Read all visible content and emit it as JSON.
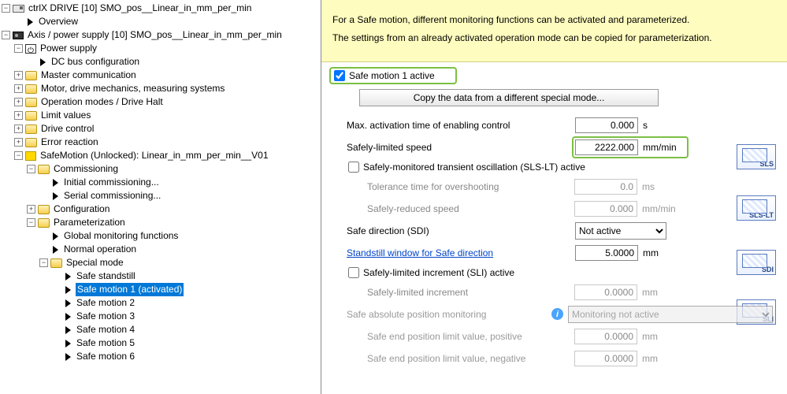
{
  "tree": {
    "root": "ctrlX DRIVE [10] SMO_pos__Linear_in_mm_per_min",
    "overview": "Overview",
    "axis": "Axis / power supply [10] SMO_pos__Linear_in_mm_per_min",
    "power_supply": "Power supply",
    "dc_bus": "DC bus configuration",
    "master_comm": "Master communication",
    "motor": "Motor, drive mechanics, measuring systems",
    "op_modes": "Operation modes / Drive Halt",
    "limit_values": "Limit values",
    "drive_control": "Drive control",
    "error_reaction": "Error reaction",
    "safemotion": "SafeMotion (Unlocked): Linear_in_mm_per_min__V01",
    "commissioning": "Commissioning",
    "initial_comm": "Initial commissioning...",
    "serial_comm": "Serial commissioning...",
    "configuration": "Configuration",
    "parameterization": "Parameterization",
    "global_mon": "Global monitoring functions",
    "normal_op": "Normal operation",
    "special_mode": "Special mode",
    "safe_standstill": "Safe standstill",
    "safe_motion_1": "Safe motion 1 (activated)",
    "safe_motion_2": "Safe motion 2",
    "safe_motion_3": "Safe motion 3",
    "safe_motion_4": "Safe motion 4",
    "safe_motion_5": "Safe motion 5",
    "safe_motion_6": "Safe motion 6"
  },
  "banner": {
    "line1": "For a Safe motion, different monitoring functions can be activated and parameterized.",
    "line2": "The settings from an already activated operation mode can be copied for parameterization."
  },
  "form": {
    "active_label": "Safe motion 1 active",
    "copy_btn": "Copy the data from a different special mode...",
    "max_act_label": "Max. activation time of enabling control",
    "max_act_val": "0.000",
    "max_act_unit": "s",
    "sls_label": "Safely-limited speed",
    "sls_val": "2222.000",
    "sls_unit": "mm/min",
    "slslt_label": "Safely-monitored transient oscillation (SLS-LT) active",
    "tol_label": "Tolerance time for overshooting",
    "tol_val": "0.0",
    "tol_unit": "ms",
    "srs_label": "Safely-reduced speed",
    "srs_val": "0.000",
    "srs_unit": "mm/min",
    "sdi_label": "Safe direction (SDI)",
    "sdi_val": "Not active",
    "standstill_label": "Standstill window for Safe direction",
    "standstill_val": "5.0000",
    "standstill_unit": "mm",
    "sli_label": "Safely-limited increment (SLI) active",
    "sli_inc_label": "Safely-limited increment",
    "sli_inc_val": "0.0000",
    "sli_inc_unit": "mm",
    "safe_abs_label": "Safe absolute position monitoring",
    "safe_abs_val": "Monitoring not active",
    "end_pos_pos_label": "Safe end position limit value, positive",
    "end_pos_pos_val": "0.0000",
    "end_pos_pos_unit": "mm",
    "end_pos_neg_label": "Safe end position limit value, negative",
    "end_pos_neg_val": "0.0000",
    "end_pos_neg_unit": "mm"
  },
  "icons": {
    "sls": "SLS",
    "slslt": "SLS-LT",
    "sdi": "SDI",
    "sli": "SLI"
  }
}
